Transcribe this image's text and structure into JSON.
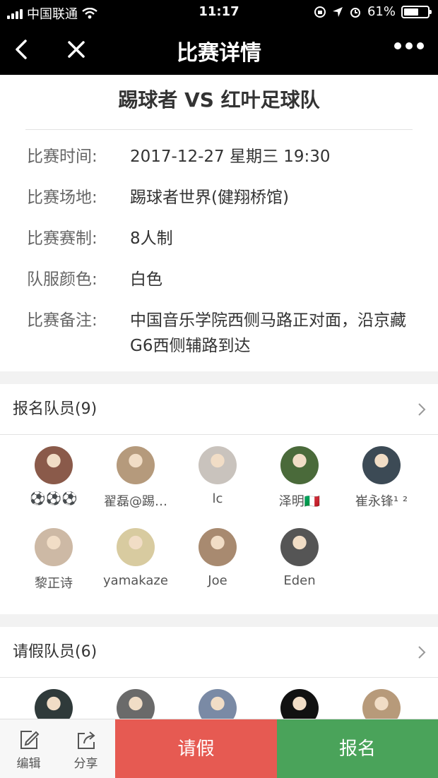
{
  "status": {
    "carrier": "中国联通",
    "time": "11:17",
    "battery": "61%",
    "battery_level": 0.61
  },
  "nav": {
    "title": "比赛详情"
  },
  "match": {
    "title": "踢球者 VS 红叶足球队",
    "info": [
      {
        "label": "比赛时间:",
        "value": "2017-12-27 星期三 19:30"
      },
      {
        "label": "比赛场地:",
        "value": "踢球者世界(健翔桥馆)"
      },
      {
        "label": "比赛赛制:",
        "value": "8人制"
      },
      {
        "label": "队服颜色:",
        "value": "白色"
      },
      {
        "label": "比赛备注:",
        "value": "中国音乐学院西侧马路正对面，沿京藏G6西侧辅路到达"
      }
    ]
  },
  "signed": {
    "title": "报名队员(9)",
    "members": [
      {
        "name": "⚽⚽⚽",
        "color": "#8a5a4a"
      },
      {
        "name": "翟磊@踢…",
        "color": "#b59a7c"
      },
      {
        "name": "lc",
        "color": "#c9c3bd"
      },
      {
        "name": "泽明🇮🇹",
        "color": "#4a6a3a"
      },
      {
        "name": "崔永锋¹ ²",
        "color": "#3c4a55"
      },
      {
        "name": "黎正诗",
        "color": "#cdb9a5"
      },
      {
        "name": "yamakaze",
        "color": "#d8cba0"
      },
      {
        "name": "Joe",
        "color": "#a88a70"
      },
      {
        "name": "Eden",
        "color": "#555555"
      }
    ]
  },
  "leave": {
    "title": "请假队员(6)",
    "members": [
      {
        "color": "#2f3a3a"
      },
      {
        "color": "#6a6a6a"
      },
      {
        "color": "#7a8aa5"
      },
      {
        "color": "#111111"
      },
      {
        "color": "#b79a7a"
      }
    ]
  },
  "toolbar": {
    "edit": "编辑",
    "share": "分享",
    "leave": "请假",
    "signup": "报名"
  }
}
